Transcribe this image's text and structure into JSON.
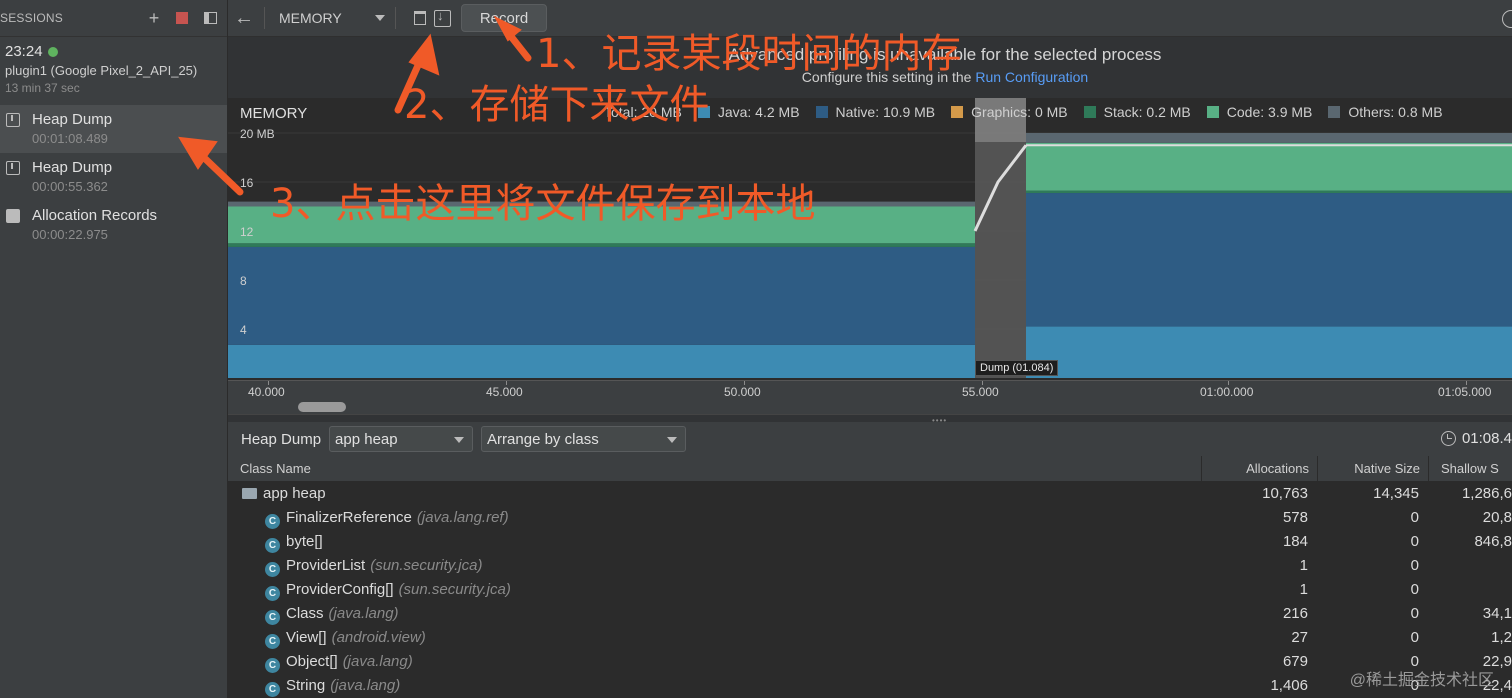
{
  "sidebar": {
    "title": "SESSIONS",
    "session": {
      "time": "23:24",
      "device": "plugin1 (Google Pixel_2_API_25)",
      "duration": "13 min 37 sec"
    },
    "artifacts": [
      {
        "name": "Heap Dump",
        "time": "00:01:08.489"
      },
      {
        "name": "Heap Dump",
        "time": "00:00:55.362"
      },
      {
        "name": "Allocation Records",
        "time": "00:00:22.975"
      }
    ]
  },
  "toolbar": {
    "profiler": "MEMORY",
    "record_label": "Record"
  },
  "banner": {
    "title": "Advanced profiling is unavailable for the selected process",
    "sub_prefix": "Configure this setting in the",
    "sub_link": "Run Configuration"
  },
  "chart_data": {
    "type": "area",
    "title": "MEMORY",
    "legend": [
      "Total: 20 MB",
      "Java: 4.2 MB",
      "Native: 10.9 MB",
      "Graphics: 0 MB",
      "Stack: 0.2 MB",
      "Code: 3.9 MB",
      "Others: 0.8 MB"
    ],
    "colors": {
      "java": "#3d8bb3",
      "native": "#2e5c84",
      "graphics": "#d49a4a",
      "stack": "#2f7a59",
      "code": "#58b085",
      "others": "#5a6770"
    },
    "y_ticks": [
      "20 MB",
      "16",
      "12",
      "8",
      "4"
    ],
    "ylim": [
      0,
      20
    ],
    "x_ticks": [
      "40.000",
      "45.000",
      "50.000",
      "55.000",
      "01:00.000",
      "01:05.000"
    ],
    "dump_label": "Dump (01.084)"
  },
  "heap_dump": {
    "title": "Heap Dump",
    "heap": "app heap",
    "arrange": "Arrange by class",
    "capture_time": "01:08.4"
  },
  "table": {
    "columns": [
      "Class Name",
      "Allocations",
      "Native Size",
      "Shallow S"
    ],
    "root": {
      "name": "app heap",
      "allocations": "10,763",
      "native": "14,345",
      "shallow": "1,286,6"
    },
    "rows": [
      {
        "name": "FinalizerReference",
        "pkg": "(java.lang.ref)",
        "allocations": "578",
        "native": "0",
        "shallow": "20,8"
      },
      {
        "name": "byte[]",
        "pkg": "",
        "allocations": "184",
        "native": "0",
        "shallow": "846,8"
      },
      {
        "name": "ProviderList",
        "pkg": "(sun.security.jca)",
        "allocations": "1",
        "native": "0",
        "shallow": ""
      },
      {
        "name": "ProviderConfig[]",
        "pkg": "(sun.security.jca)",
        "allocations": "1",
        "native": "0",
        "shallow": ""
      },
      {
        "name": "Class",
        "pkg": "(java.lang)",
        "allocations": "216",
        "native": "0",
        "shallow": "34,1"
      },
      {
        "name": "View[]",
        "pkg": "(android.view)",
        "allocations": "27",
        "native": "0",
        "shallow": "1,2"
      },
      {
        "name": "Object[]",
        "pkg": "(java.lang)",
        "allocations": "679",
        "native": "0",
        "shallow": "22,9"
      },
      {
        "name": "String",
        "pkg": "(java.lang)",
        "allocations": "1,406",
        "native": "0",
        "shallow": "22,4"
      }
    ]
  },
  "annotations": {
    "a1": "1、记录某段时间的内存",
    "a2": "2、存储下来文件",
    "a3": "3、点击这里将文件保存到本地"
  },
  "watermark": "@稀土掘金技术社区"
}
